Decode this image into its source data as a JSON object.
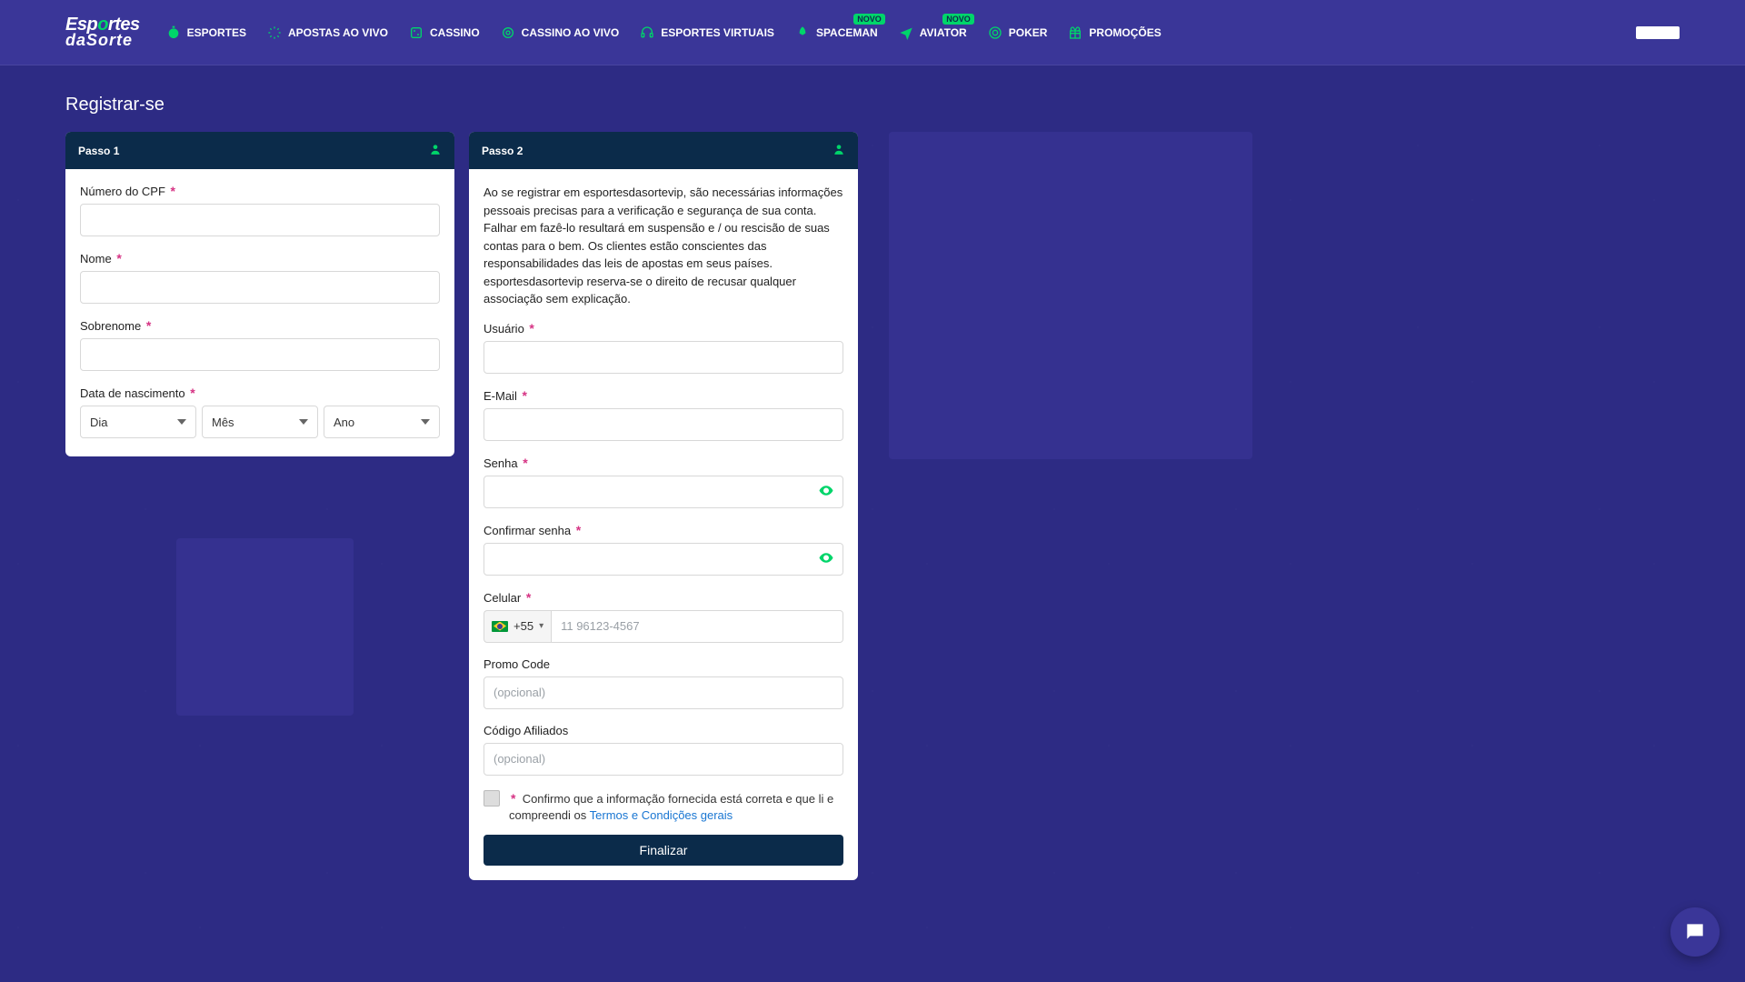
{
  "brand": {
    "line1a": "Esp",
    "line1b": "o",
    "line1c": "rtes",
    "line2": "daSorte"
  },
  "nav": [
    {
      "label": "ESPORTES"
    },
    {
      "label": "APOSTAS AO VIVO"
    },
    {
      "label": "CASSINO"
    },
    {
      "label": "CASSINO AO VIVO"
    },
    {
      "label": "ESPORTES VIRTUAIS"
    },
    {
      "label": "SPACEMAN",
      "badge": "Novo"
    },
    {
      "label": "AVIATOR",
      "badge": "Novo"
    },
    {
      "label": "POKER"
    },
    {
      "label": "PROMOÇÕES"
    }
  ],
  "page": {
    "title": "Registrar-se"
  },
  "step1": {
    "title": "Passo 1",
    "cpf_label": "Número do CPF",
    "nome_label": "Nome",
    "sobrenome_label": "Sobrenome",
    "dob_label": "Data de nascimento",
    "dob_dia": "Dia",
    "dob_mes": "Mês",
    "dob_ano": "Ano"
  },
  "step2": {
    "title": "Passo 2",
    "intro": "Ao se registrar em esportesdasortevip, são necessárias informações pessoais precisas para a verificação e segurança de sua conta. Falhar em fazê-lo resultará em suspensão e / ou rescisão de suas contas para o bem. Os clientes estão conscientes das responsabilidades das leis de apostas em seus países. esportesdasortevip reserva-se o direito de recusar qualquer associação sem explicação.",
    "usuario_label": "Usuário",
    "email_label": "E-Mail",
    "senha_label": "Senha",
    "confirma_label": "Confirmar senha",
    "celular_label": "Celular",
    "dial_code": "+55",
    "celular_placeholder": "11 96123-4567",
    "promo_label": "Promo Code",
    "promo_placeholder": "(opcional)",
    "afiliados_label": "Código Afiliados",
    "afiliados_placeholder": "(opcional)",
    "terms_text": "Confirmo que a informação fornecida está correta e que li e compreendi os ",
    "terms_link": "Termos e Condições gerais",
    "submit": "Finalizar"
  },
  "required_mark": "*"
}
